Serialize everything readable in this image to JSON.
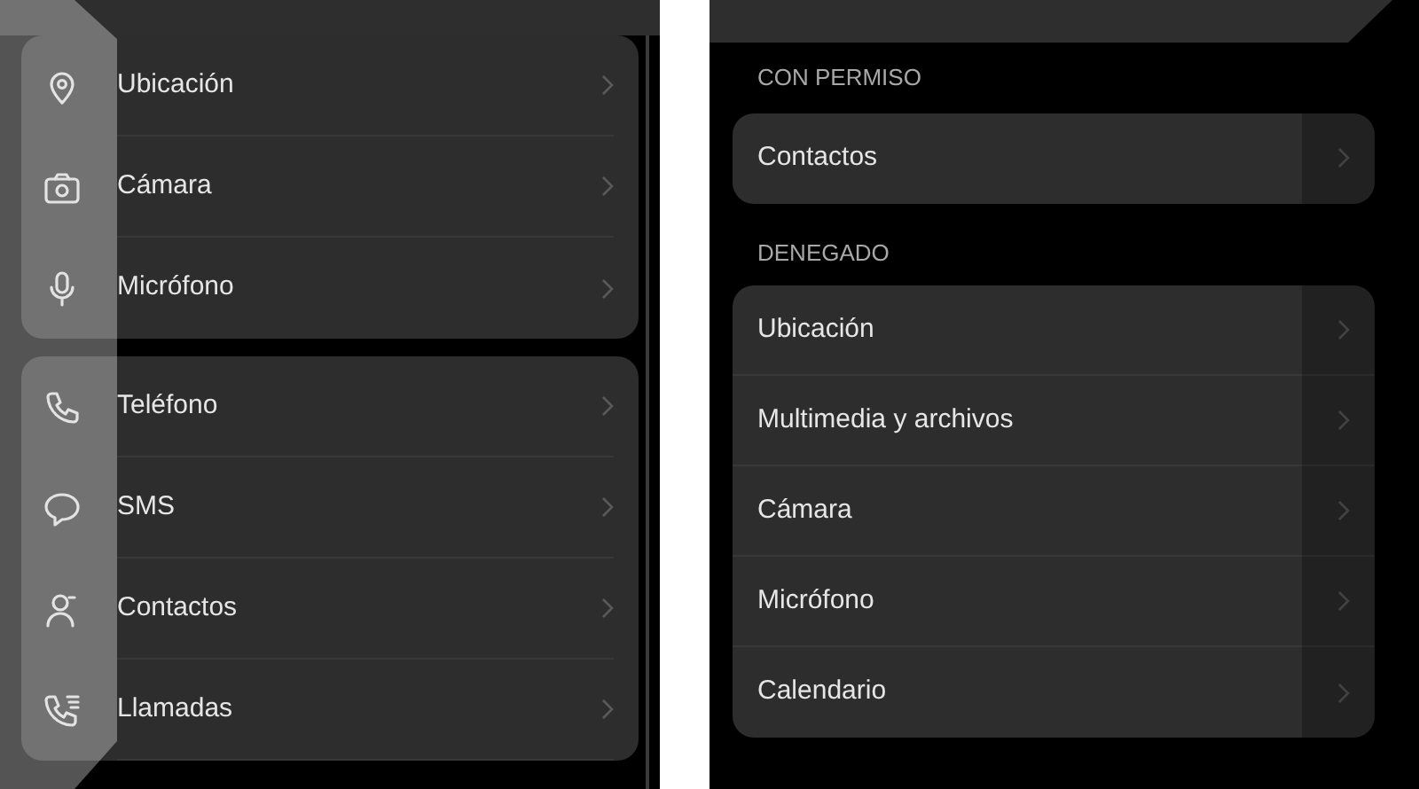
{
  "left_panel": {
    "groups": [
      {
        "items": [
          {
            "label": "Ubicación",
            "kind": "location"
          },
          {
            "label": "Cámara",
            "kind": "camera"
          },
          {
            "label": "Micrófono",
            "kind": "microphone"
          }
        ]
      },
      {
        "items": [
          {
            "label": "Teléfono",
            "kind": "phone"
          },
          {
            "label": "SMS",
            "kind": "message"
          },
          {
            "label": "Contactos",
            "kind": "person"
          },
          {
            "label": "Llamadas",
            "kind": "calls"
          }
        ]
      }
    ]
  },
  "right_panel": {
    "sections": [
      {
        "heading": "CON PERMISO",
        "items": [
          {
            "label": "Contactos"
          }
        ]
      },
      {
        "heading": "DENEGADO",
        "items": [
          {
            "label": "Ubicación"
          },
          {
            "label": "Multimedia y archivos"
          },
          {
            "label": "Cámara"
          },
          {
            "label": "Micrófono"
          },
          {
            "label": "Calendario"
          }
        ]
      }
    ]
  }
}
